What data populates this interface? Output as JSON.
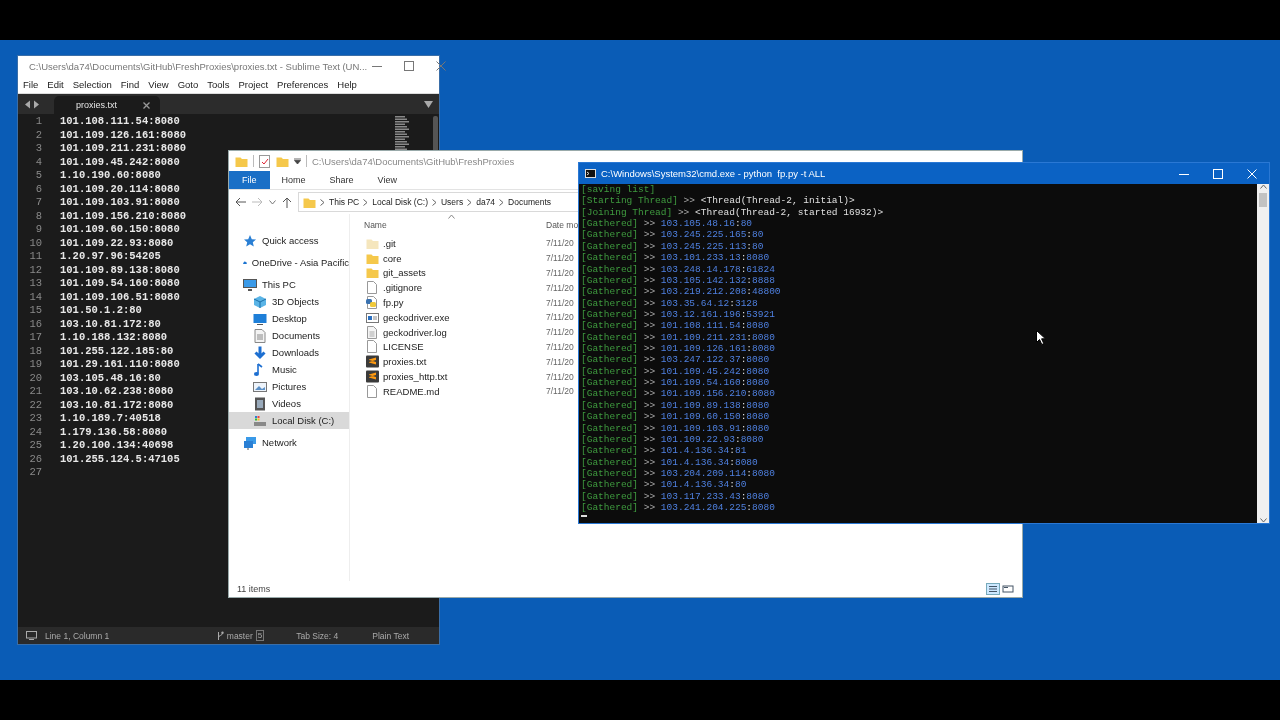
{
  "sublime": {
    "title": "C:\\Users\\da74\\Documents\\GitHub\\FreshProxies\\proxies.txt - Sublime Text (UN...",
    "menu": [
      "File",
      "Edit",
      "Selection",
      "Find",
      "View",
      "Goto",
      "Tools",
      "Project",
      "Preferences",
      "Help"
    ],
    "tabs": [
      {
        "label": "proxies.txt",
        "selected": true
      }
    ],
    "lines": [
      {
        "number": "1",
        "text": "101.108.111.54:8080"
      },
      {
        "number": "2",
        "text": "101.109.126.161:8080"
      },
      {
        "number": "3",
        "text": "101.109.211.231:8080"
      },
      {
        "number": "4",
        "text": "101.109.45.242:8080"
      },
      {
        "number": "5",
        "text": "1.10.190.60:8080"
      },
      {
        "number": "6",
        "text": "101.109.20.114:8080"
      },
      {
        "number": "7",
        "text": "101.109.103.91:8080"
      },
      {
        "number": "8",
        "text": "101.109.156.210:8080"
      },
      {
        "number": "9",
        "text": "101.109.60.150:8080"
      },
      {
        "number": "10",
        "text": "101.109.22.93:8080"
      },
      {
        "number": "11",
        "text": "1.20.97.96:54205"
      },
      {
        "number": "12",
        "text": "101.109.89.138:8080"
      },
      {
        "number": "13",
        "text": "101.109.54.160:8080"
      },
      {
        "number": "14",
        "text": "101.109.106.51:8080"
      },
      {
        "number": "15",
        "text": "101.50.1.2:80"
      },
      {
        "number": "16",
        "text": "103.10.81.172:80"
      },
      {
        "number": "17",
        "text": "1.10.188.132:8080"
      },
      {
        "number": "18",
        "text": "101.255.122.185:80"
      },
      {
        "number": "19",
        "text": "101.29.161.110:8080"
      },
      {
        "number": "20",
        "text": "103.105.48.16:80"
      },
      {
        "number": "21",
        "text": "103.10.62.238:8080"
      },
      {
        "number": "22",
        "text": "103.10.81.172:8080"
      },
      {
        "number": "23",
        "text": "1.10.189.7:40518"
      },
      {
        "number": "24",
        "text": "1.179.136.58:8080"
      },
      {
        "number": "25",
        "text": "1.20.100.134:40698"
      },
      {
        "number": "26",
        "text": "101.255.124.5:47105"
      },
      {
        "number": "27"
      }
    ],
    "status_bar": {
      "position": "Line 1, Column 1",
      "branch": "master",
      "changes": "5",
      "tab_size": "Tab Size: 4",
      "syntax": "Plain Text"
    }
  },
  "explorer": {
    "title": "C:\\Users\\da74\\Documents\\GitHub\\FreshProxies",
    "ribbon_tabs": [
      {
        "label": "File",
        "selected": true
      },
      {
        "label": "Home",
        "selected": false
      },
      {
        "label": "Share",
        "selected": false
      },
      {
        "label": "View",
        "selected": false
      }
    ],
    "breadcrumbs": [
      "This PC",
      "Local Disk (C:)",
      "Users",
      "da74",
      "Documents"
    ],
    "navigation": [
      {
        "label": "Quick access",
        "kind": "star",
        "selected": false
      },
      {
        "label": "OneDrive - Asia Pacific",
        "kind": "cloud",
        "selected": false
      },
      {
        "label": "This PC",
        "kind": "computer",
        "selected": false,
        "children": [
          {
            "label": "3D Objects",
            "kind": "cube",
            "selected": false
          },
          {
            "label": "Desktop",
            "kind": "desktop",
            "selected": false
          },
          {
            "label": "Documents",
            "kind": "documents",
            "selected": false
          },
          {
            "label": "Downloads",
            "kind": "downloads",
            "selected": false
          },
          {
            "label": "Music",
            "kind": "music",
            "selected": false
          },
          {
            "label": "Pictures",
            "kind": "pictures",
            "selected": false
          },
          {
            "label": "Videos",
            "kind": "videos",
            "selected": false
          },
          {
            "label": "Local Disk (C:)",
            "kind": "drive",
            "selected": true
          }
        ]
      },
      {
        "label": "Network",
        "kind": "network",
        "selected": false
      }
    ],
    "columns": [
      "Name",
      "Date mo"
    ],
    "files": [
      {
        "name": ".git",
        "date": "7/11/20",
        "kind": "hidden-folder"
      },
      {
        "name": "core",
        "date": "7/11/20",
        "kind": "folder"
      },
      {
        "name": "git_assets",
        "date": "7/11/20",
        "kind": "folder"
      },
      {
        "name": ".gitignore",
        "date": "7/11/20",
        "kind": "file"
      },
      {
        "name": "fp.py",
        "date": "7/11/20",
        "kind": "python"
      },
      {
        "name": "geckodriver.exe",
        "date": "7/11/20",
        "kind": "application"
      },
      {
        "name": "geckodriver.log",
        "date": "7/11/20",
        "kind": "text"
      },
      {
        "name": "LICENSE",
        "date": "7/11/20",
        "kind": "file"
      },
      {
        "name": "proxies.txt",
        "date": "7/11/20",
        "kind": "sublime"
      },
      {
        "name": "proxies_http.txt",
        "date": "7/11/20",
        "kind": "sublime"
      },
      {
        "name": "README.md",
        "date": "7/11/20",
        "kind": "file"
      }
    ],
    "status": "11 items"
  },
  "console": {
    "title": "C:\\Windows\\System32\\cmd.exe - python  fp.py -t ALL",
    "lines": [
      {
        "kind": "status",
        "tag": "[saving list]"
      },
      {
        "kind": "thread",
        "tag": "[Starting Thread]",
        "arrow": ">>",
        "value": "<Thread(Thread-2, initial)>"
      },
      {
        "kind": "thread",
        "tag": "[Joining Thread]",
        "arrow": ">>",
        "value": "<Thread(Thread-2, started 16932)>"
      },
      {
        "kind": "gathered",
        "tag": "[Gathered]",
        "arrow": ">>",
        "value": "103.105.48.16:80"
      },
      {
        "kind": "gathered",
        "tag": "[Gathered]",
        "arrow": ">>",
        "value": "103.245.225.165:80"
      },
      {
        "kind": "gathered",
        "tag": "[Gathered]",
        "arrow": ">>",
        "value": "103.245.225.113:80"
      },
      {
        "kind": "gathered",
        "tag": "[Gathered]",
        "arrow": ">>",
        "value": "103.101.233.13:8080"
      },
      {
        "kind": "gathered",
        "tag": "[Gathered]",
        "arrow": ">>",
        "value": "103.248.14.178:61824"
      },
      {
        "kind": "gathered",
        "tag": "[Gathered]",
        "arrow": ">>",
        "value": "103.105.142.132:8888"
      },
      {
        "kind": "gathered",
        "tag": "[Gathered]",
        "arrow": ">>",
        "value": "103.219.212.208:48800"
      },
      {
        "kind": "gathered",
        "tag": "[Gathered]",
        "arrow": ">>",
        "value": "103.35.64.12:3128"
      },
      {
        "kind": "gathered",
        "tag": "[Gathered]",
        "arrow": ">>",
        "value": "103.12.161.196:53921"
      },
      {
        "kind": "gathered",
        "tag": "[Gathered]",
        "arrow": ">>",
        "value": "101.108.111.54:8080"
      },
      {
        "kind": "gathered",
        "tag": "[Gathered]",
        "arrow": ">>",
        "value": "101.109.211.231:8080"
      },
      {
        "kind": "gathered",
        "tag": "[Gathered]",
        "arrow": ">>",
        "value": "101.109.126.161:8080"
      },
      {
        "kind": "gathered",
        "tag": "[Gathered]",
        "arrow": ">>",
        "value": "103.247.122.37:8080"
      },
      {
        "kind": "gathered",
        "tag": "[Gathered]",
        "arrow": ">>",
        "value": "101.109.45.242:8080"
      },
      {
        "kind": "gathered",
        "tag": "[Gathered]",
        "arrow": ">>",
        "value": "101.109.54.160:8080"
      },
      {
        "kind": "gathered",
        "tag": "[Gathered]",
        "arrow": ">>",
        "value": "101.109.156.210:8080"
      },
      {
        "kind": "gathered",
        "tag": "[Gathered]",
        "arrow": ">>",
        "value": "101.109.89.138:8080"
      },
      {
        "kind": "gathered",
        "tag": "[Gathered]",
        "arrow": ">>",
        "value": "101.109.60.150:8080"
      },
      {
        "kind": "gathered",
        "tag": "[Gathered]",
        "arrow": ">>",
        "value": "101.109.103.91:8080"
      },
      {
        "kind": "gathered",
        "tag": "[Gathered]",
        "arrow": ">>",
        "value": "101.109.22.93:8080"
      },
      {
        "kind": "gathered",
        "tag": "[Gathered]",
        "arrow": ">>",
        "value": "101.4.136.34:81"
      },
      {
        "kind": "gathered",
        "tag": "[Gathered]",
        "arrow": ">>",
        "value": "101.4.136.34:8080"
      },
      {
        "kind": "gathered",
        "tag": "[Gathered]",
        "arrow": ">>",
        "value": "103.204.209.114:8080"
      },
      {
        "kind": "gathered",
        "tag": "[Gathered]",
        "arrow": ">>",
        "value": "101.4.136.34:80"
      },
      {
        "kind": "gathered",
        "tag": "[Gathered]",
        "arrow": ">>",
        "value": "103.117.233.43:8080"
      },
      {
        "kind": "gathered",
        "tag": "[Gathered]",
        "arrow": ">>",
        "value": "103.241.204.225:8080"
      }
    ]
  }
}
